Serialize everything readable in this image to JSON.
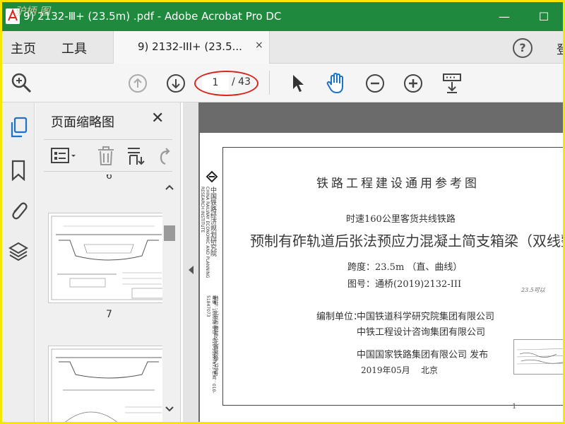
{
  "window": {
    "title": "9)  2132-Ⅲ+   (23.5m)  .pdf - Adobe Acrobat Pro DC",
    "watermark": "驴柄 图",
    "minimize": "—",
    "maximize": "☐"
  },
  "menu": {
    "home": "主页",
    "tools": "工具",
    "tab_label": "9)  2132-III+   (23.5...",
    "tab_close": "×",
    "help": "?",
    "login": "登"
  },
  "toolbar": {
    "page_current": "1",
    "page_total": "/ 43"
  },
  "panel": {
    "title": "页面缩略图",
    "close": "✕",
    "labels": [
      "6",
      "7"
    ]
  },
  "document": {
    "heading": "铁路工程建设通用参考图",
    "subtitle": "时速160公里客货共线铁路",
    "title": "预制有砟轨道后张法预应力混凝土简支箱梁（双线整孔）",
    "span": "跨度：23.5m   （直、曲线）",
    "drawing_no": "图号：通桥(2019)2132-III",
    "handwritten": "23.5可以",
    "editor_label": "编制单位：",
    "editor_1": "中国铁道科学研究院集团有限公司",
    "editor_2": "中铁工程设计咨询集团有限公司",
    "publisher": "中国国家铁路集团有限公司   发布",
    "date": "2019年05月",
    "place": "北京",
    "org_vertical": "中国铁路经济规划研究院",
    "org_en": "CHINA RAILWAY ECONOMIC AND PLANNING RESEARCH INSTITUTE",
    "address": "地址：北京市海淀区北蜂窝路乙29号",
    "contact": "邮编：100038  电话：010-51897673  传真：010-51847073",
    "page_number": "1"
  },
  "colors": {
    "titlebar": "#1f8a3e",
    "frame": "#f5e800",
    "annotation": "#d8251e",
    "hand_tool": "#1a73c8"
  }
}
